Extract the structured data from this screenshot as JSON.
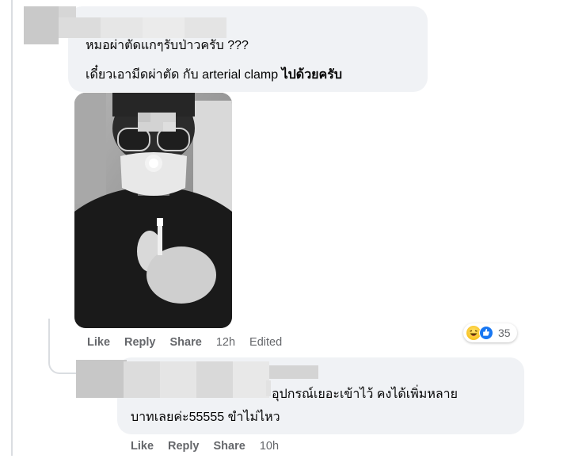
{
  "comment1": {
    "text_line1": "หมอผ่าตัดแกๆรับป่าวครับ ???",
    "text_line2_thai": "เดี๋ยวเอามีดผ่าตัด กับ",
    "text_line2_en": "arterial clamp",
    "text_line2_end": "ไปด้วยครับ",
    "actions": {
      "like": "Like",
      "reply": "Reply",
      "share": "Share"
    },
    "time": "12h",
    "edited": "Edited",
    "reactions": {
      "icons": [
        "haha-icon",
        "like-icon"
      ],
      "count": "35"
    }
  },
  "comment2": {
    "text_line1": "อุปกรณ์เยอะเข้าไว้ คงได้เพิ่มหลาย",
    "text_line2": "บาทเลยค่ะ55555 ขำไม่ไหว",
    "actions": {
      "like": "Like",
      "reply": "Reply",
      "share": "Share"
    },
    "time": "10h"
  }
}
